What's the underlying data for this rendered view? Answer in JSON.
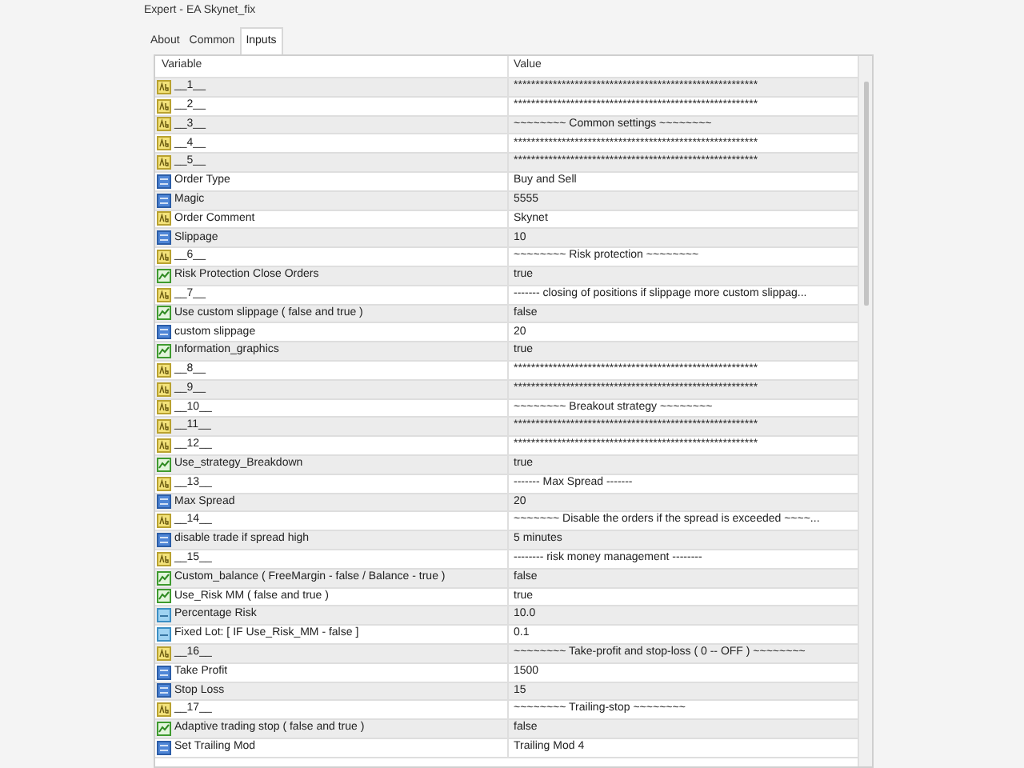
{
  "window": {
    "title": "Expert - EA Skynet_fix"
  },
  "tabs": [
    {
      "label": "About",
      "selected": false
    },
    {
      "label": "Common",
      "selected": false
    },
    {
      "label": "Inputs",
      "selected": true
    }
  ],
  "table": {
    "columns": [
      "Variable",
      "Value"
    ],
    "rows": [
      {
        "kind": "string",
        "variable": "__1__",
        "value": "********************************************************"
      },
      {
        "kind": "string",
        "variable": "__2__",
        "value": "********************************************************"
      },
      {
        "kind": "string",
        "variable": "__3__",
        "value": "~~~~~~~~ Common settings ~~~~~~~~"
      },
      {
        "kind": "string",
        "variable": "__4__",
        "value": "********************************************************"
      },
      {
        "kind": "string",
        "variable": "__5__",
        "value": "********************************************************"
      },
      {
        "kind": "int",
        "variable": "Order Type",
        "value": "Buy and Sell"
      },
      {
        "kind": "int",
        "variable": "Magic",
        "value": "5555"
      },
      {
        "kind": "string",
        "variable": "Order Comment",
        "value": "Skynet"
      },
      {
        "kind": "int",
        "variable": "Slippage",
        "value": "10"
      },
      {
        "kind": "string",
        "variable": "__6__",
        "value": "~~~~~~~~ Risk protection ~~~~~~~~"
      },
      {
        "kind": "bool",
        "variable": "Risk Protection Close Orders",
        "value": "true"
      },
      {
        "kind": "string",
        "variable": "__7__",
        "value": "------- closing of positions if slippage more custom slippag..."
      },
      {
        "kind": "bool",
        "variable": "Use custom slippage ( false and true )",
        "value": "false"
      },
      {
        "kind": "int",
        "variable": "custom slippage",
        "value": "20"
      },
      {
        "kind": "bool",
        "variable": "Information_graphics",
        "value": "true"
      },
      {
        "kind": "string",
        "variable": "__8__",
        "value": "********************************************************"
      },
      {
        "kind": "string",
        "variable": "__9__",
        "value": "********************************************************"
      },
      {
        "kind": "string",
        "variable": "__10__",
        "value": "~~~~~~~~ Breakout strategy ~~~~~~~~"
      },
      {
        "kind": "string",
        "variable": "__11__",
        "value": "********************************************************"
      },
      {
        "kind": "string",
        "variable": "__12__",
        "value": "********************************************************"
      },
      {
        "kind": "bool",
        "variable": "Use_strategy_Breakdown",
        "value": "true"
      },
      {
        "kind": "string",
        "variable": "__13__",
        "value": "------- Max Spread -------"
      },
      {
        "kind": "int",
        "variable": "Max Spread",
        "value": "20"
      },
      {
        "kind": "string",
        "variable": "__14__",
        "value": "~~~~~~~ Disable the orders if the spread is exceeded ~~~~..."
      },
      {
        "kind": "int",
        "variable": "disable trade if spread high",
        "value": "5 minutes"
      },
      {
        "kind": "string",
        "variable": "__15__",
        "value": "-------- risk money management --------"
      },
      {
        "kind": "bool",
        "variable": "Custom_balance ( FreeMargin - false / Balance - true )",
        "value": "false"
      },
      {
        "kind": "bool",
        "variable": "Use_Risk MM ( false and true )",
        "value": "true"
      },
      {
        "kind": "double",
        "variable": "Percentage Risk",
        "value": "10.0"
      },
      {
        "kind": "double",
        "variable": "Fixed Lot: [ IF  Use_Risk_MM - false ]",
        "value": "0.1"
      },
      {
        "kind": "string",
        "variable": "__16__",
        "value": "~~~~~~~~ Take-profit and stop-loss ( 0 -- OFF ) ~~~~~~~~"
      },
      {
        "kind": "int",
        "variable": "Take Profit",
        "value": "1500"
      },
      {
        "kind": "int",
        "variable": "Stop Loss",
        "value": "15"
      },
      {
        "kind": "string",
        "variable": "__17__",
        "value": "~~~~~~~~ Trailing-stop ~~~~~~~~"
      },
      {
        "kind": "bool",
        "variable": "Adaptive trading stop ( false and true )",
        "value": "false"
      },
      {
        "kind": "int",
        "variable": "Set Trailing Mod",
        "value": "Trailing Mod 4"
      }
    ]
  }
}
